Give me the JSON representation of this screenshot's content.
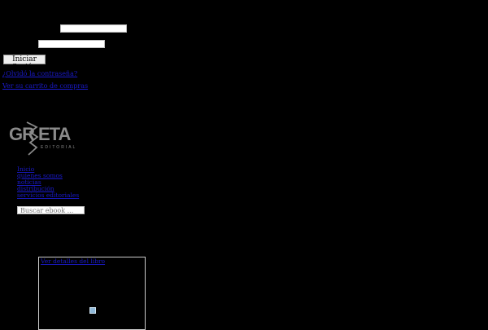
{
  "login": {
    "username_value": "",
    "password_value": "",
    "submit_label": "Iniciar Sesión",
    "forgot_password_link": "¿Olvidó la contraseña?",
    "cart_link": "Ver su carrito de compras"
  },
  "brand": {
    "logo_text": "GRIETA",
    "logo_subtext": "EDITORIAL"
  },
  "nav": {
    "items": [
      {
        "label": "Inicio"
      },
      {
        "label": "quienes somos"
      },
      {
        "label": "noticias"
      },
      {
        "label": "distribución"
      },
      {
        "label": "servicios editoriales"
      }
    ]
  },
  "search": {
    "placeholder": "Buscar ebook ...",
    "value": ""
  },
  "book": {
    "details_link": "Ver detalles del libro"
  }
}
